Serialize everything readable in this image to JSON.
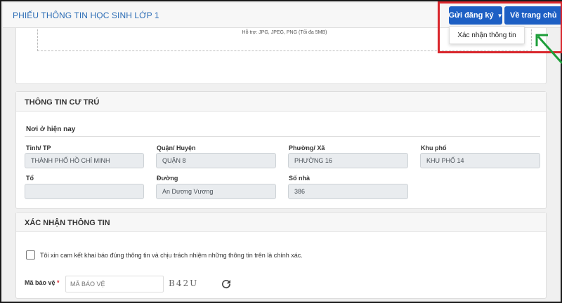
{
  "header": {
    "title": "PHIẾU THÔNG TIN HỌC SINH LỚP 1",
    "submit_button": "Gửi đăng ký",
    "home_button": "Về trang chủ",
    "dropdown_item": "Xác nhận thông tin"
  },
  "upload": {
    "hint": "Hỗ trợ: JPG, JPEG, PNG (Tối đa 5MB)"
  },
  "residence": {
    "section_title": "THÔNG TIN CƯ TRÚ",
    "subsection": "Nơi ở hiện nay",
    "fields": {
      "province": {
        "label": "Tỉnh/ TP",
        "value": "THÀNH PHỐ HỒ CHÍ MINH"
      },
      "district": {
        "label": "Quận/ Huyện",
        "value": "QUẬN 8"
      },
      "ward": {
        "label": "Phường/ Xã",
        "value": "PHƯỜNG 16"
      },
      "quarter": {
        "label": "Khu phố",
        "value": "KHU PHỐ 14"
      },
      "group": {
        "label": "Tổ",
        "value": ""
      },
      "street": {
        "label": "Đường",
        "value": "An Dương Vương"
      },
      "house_no": {
        "label": "Số nhà",
        "value": "386"
      }
    }
  },
  "confirm": {
    "section_title": "XÁC NHẬN THÔNG TIN",
    "commit_text": "Tôi xin cam kết khai báo đúng thông tin và chịu trách nhiệm những thông tin trên là chính xác.",
    "committed": false,
    "captcha_label": "Mã bảo vệ",
    "captcha_required_mark": "*",
    "captcha_placeholder": "MÃ BẢO VỆ",
    "captcha_value": "",
    "captcha_text": "B42U"
  },
  "colors": {
    "primary": "#1d5fc4",
    "highlight": "#d9262c",
    "arrow": "#1e9e3a"
  },
  "icons": {
    "caret": "caret-down-icon",
    "refresh": "refresh-icon",
    "arrow": "pointer-arrow-icon"
  }
}
